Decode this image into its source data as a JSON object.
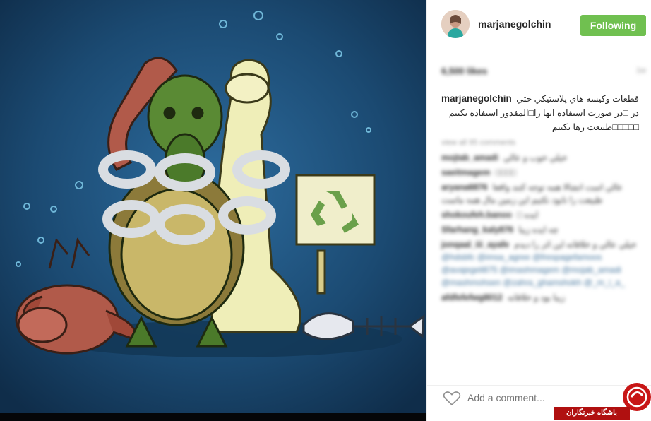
{
  "post": {
    "username": "marjanegolchin",
    "follow_label": "Following",
    "likes_text": "6,500 likes",
    "time_ago": "1w",
    "caption": {
      "username": "marjanegolchin",
      "line1": "قطعات وكيسه هاي پلاستيكي حتي",
      "line2": "در □در صورت استفاده انها را□المقدور استفاده نكنيم",
      "line3": "□□□□□طبيعت رها نكنيم"
    }
  },
  "comments": {
    "load_more": "view all 95 comments",
    "items": [
      {
        "user": "mojtab_amadi",
        "text": "خيلي خوب و عالي"
      },
      {
        "user": "saeitmagem",
        "text": "□□□□"
      },
      {
        "user": "aryana6876",
        "text": "عالي است انشالا همه توجه كنند واقعا طبيعت را نابود نكنيم اين زمين مال همه ماست"
      },
      {
        "user": "shokoufeh.banoo",
        "text": "□ ايده"
      },
      {
        "user": "Sfarhang_kaly876",
        "text": "چه ايده زيبا"
      },
      {
        "user": "jonqaal_iii_ayafe",
        "text": "خيلي عالي و خلاقانه اين اثر را ديدم",
        "links": "@hdsbfc @imsa_agree @frespagefamoos @avajegeli875 @imashmagem @mojab_amadi @mashmohsen @zahra_ghamshokh @_m_i_a_"
      },
      {
        "user": "afdfefefwg8012",
        "text": "زيبا بود و خلاقانه"
      }
    ]
  },
  "add_comment": {
    "placeholder": "Add a comment..."
  },
  "watermark": {
    "label": "باشگاه خبرنگاران"
  },
  "colors": {
    "follow_button": "#70c050",
    "ocean": "#1b4a72",
    "watermark_red": "#b01010"
  },
  "icons": {
    "heart": "heart-icon",
    "recycle": "recycle-icon"
  }
}
